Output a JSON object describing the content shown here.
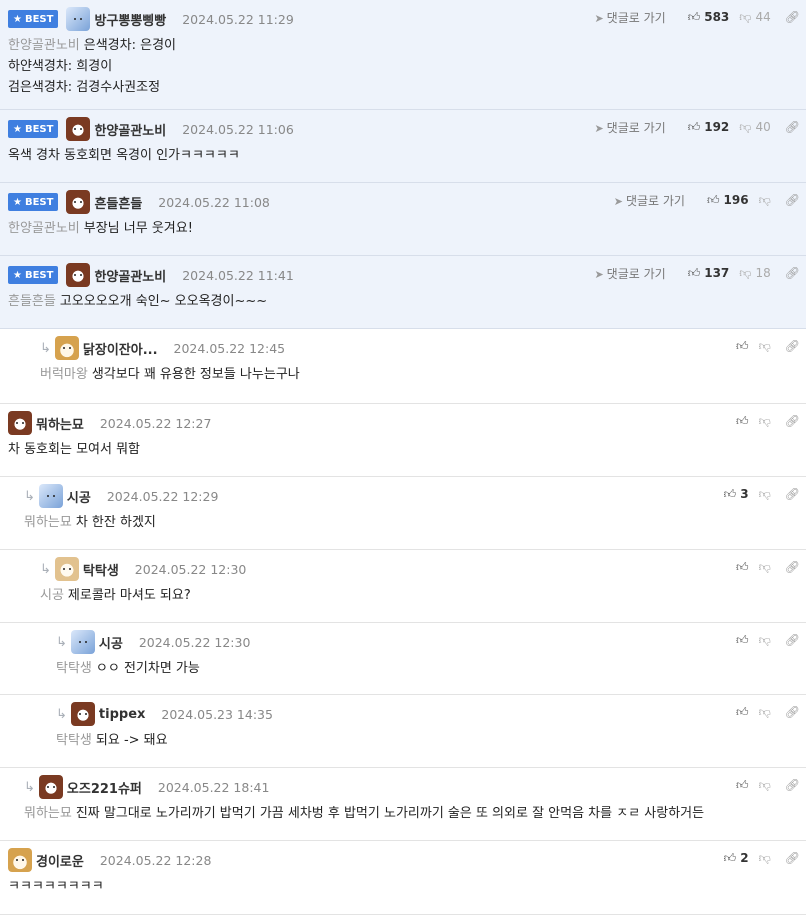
{
  "ui": {
    "best_label": "BEST",
    "goto_label": "댓글로 가기"
  },
  "comments": [
    {
      "best": true,
      "author": "방구뽕뽕삥빵",
      "date": "2024.05.22 11:29",
      "target": "한양골관노비",
      "text": [
        "은색경차: 은경이",
        "하얀색경차: 희경이",
        "검은색경차: 검경수사권조정"
      ],
      "up": "583",
      "down": "44",
      "avatar": "blue"
    },
    {
      "best": true,
      "author": "한양골관노비",
      "date": "2024.05.22 11:06",
      "target": "",
      "text": [
        "옥색 경차 동호회면 옥경이 인가ㅋㅋㅋㅋㅋ"
      ],
      "up": "192",
      "down": "40",
      "avatar": "dog"
    },
    {
      "best": true,
      "author": "흔들흔들",
      "date": "2024.05.22 11:08",
      "target": "한양골관노비",
      "text": [
        "부장님 너무 웃겨요!"
      ],
      "up": "196",
      "down": "",
      "avatar": "dog"
    },
    {
      "best": true,
      "author": "한양골관노비",
      "date": "2024.05.22 11:41",
      "target": "흔들흔들",
      "text": [
        "고오오오오개 숙인~ 오오옥경이~~~"
      ],
      "up": "137",
      "down": "18",
      "avatar": "dog"
    },
    {
      "best": false,
      "author": "닭장이잔아...",
      "date": "2024.05.22 12:45",
      "target": "버럭마왕",
      "text": [
        "생각보다 꽤 유용한 정보들 나누는구나"
      ],
      "up": "",
      "down": "",
      "avatar": "fox"
    },
    {
      "best": false,
      "author": "뭐하는묘",
      "date": "2024.05.22 12:27",
      "target": "",
      "text": [
        "차 동호회는 모여서 뭐함"
      ],
      "up": "",
      "down": "",
      "avatar": "dog"
    },
    {
      "best": false,
      "author": "시공",
      "date": "2024.05.22 12:29",
      "target": "뭐하는묘",
      "text": [
        "차 한잔 하겠지"
      ],
      "up": "3",
      "down": "",
      "avatar": "blue"
    },
    {
      "best": false,
      "author": "탁탁생",
      "date": "2024.05.22 12:30",
      "target": "시공",
      "text": [
        "제로콜라 마셔도 되요?"
      ],
      "up": "",
      "down": "",
      "avatar": "tan"
    },
    {
      "best": false,
      "author": "시공",
      "date": "2024.05.22 12:30",
      "target": "탁탁생",
      "text": [
        "ㅇㅇ 전기차면 가능"
      ],
      "up": "",
      "down": "",
      "avatar": "blue"
    },
    {
      "best": false,
      "author": "tippex",
      "date": "2024.05.23 14:35",
      "target": "탁탁생",
      "text": [
        "되요 -> 돼요"
      ],
      "up": "",
      "down": "",
      "avatar": "dog"
    },
    {
      "best": false,
      "author": "오즈221슈퍼",
      "date": "2024.05.22 18:41",
      "target": "뭐하는묘",
      "text": [
        "진짜 말그대로 노가리까기 밥먹기 가끔 세차벙 후 밥먹기 노가리까기 술은 또 의외로 잘 안먹음 차를 ㅈㄹ 사랑하거든"
      ],
      "up": "",
      "down": "",
      "avatar": "dog"
    },
    {
      "best": false,
      "author": "경이로운",
      "date": "2024.05.22 12:28",
      "target": "",
      "text": [
        "ㅋㅋㅋㅋㅋㅋㅋㅋ"
      ],
      "up": "2",
      "down": "",
      "avatar": "fox"
    }
  ]
}
